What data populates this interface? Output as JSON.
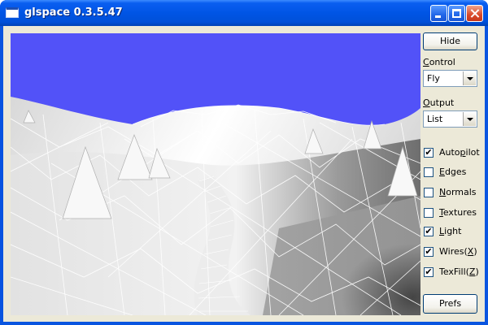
{
  "window": {
    "title": "glspace 0.3.5.47",
    "icons": [
      "app-icon",
      "minimize-icon",
      "maximize-icon",
      "close-icon"
    ]
  },
  "colors": {
    "titlebar": "#0055e5",
    "sky": "#5252f8",
    "panel": "#ece9d8"
  },
  "panel": {
    "hide_button": "Hide",
    "control_label_prefix": "C",
    "control_label_rest": "ontrol",
    "control_value": "Fly",
    "output_label_prefix": "O",
    "output_label_rest": "utput",
    "output_value": "List",
    "prefs_button": "Prefs",
    "checkboxes": [
      {
        "pre": "Auto",
        "u": "p",
        "post": "ilot",
        "checked": true
      },
      {
        "pre": "",
        "u": "E",
        "post": "dges",
        "checked": false
      },
      {
        "pre": "",
        "u": "N",
        "post": "ormals",
        "checked": false
      },
      {
        "pre": "",
        "u": "T",
        "post": "extures",
        "checked": false
      },
      {
        "pre": "",
        "u": "L",
        "post": "ight",
        "checked": true
      },
      {
        "pre": "Wires(",
        "u": "X",
        "post": ")",
        "checked": true
      },
      {
        "pre": "TexFill(",
        "u": "Z",
        "post": ")",
        "checked": true
      }
    ]
  }
}
